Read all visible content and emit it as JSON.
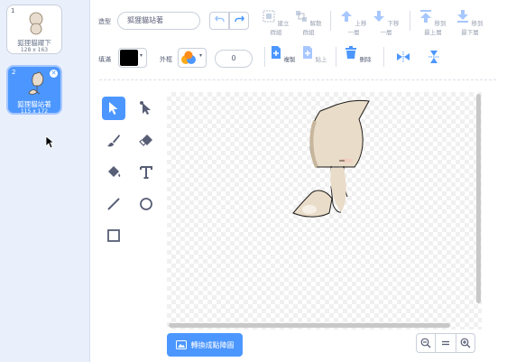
{
  "costumes": [
    {
      "num": "1",
      "name": "狐狸貓躍下",
      "size": "128 x 163"
    },
    {
      "num": "2",
      "name": "狐狸貓站著",
      "size": "115 x 172"
    }
  ],
  "editor": {
    "costume_label": "造型",
    "costume_name": "狐狸貓站著",
    "fill_label": "填滿",
    "outline_label": "外框",
    "outline_width": "0"
  },
  "toolbar": {
    "group": "建立群組",
    "ungroup": "解散群組",
    "forward": "上移一層",
    "backward": "下移一層",
    "front": "移到最上層",
    "back": "移到最下層",
    "copy": "複製",
    "paste": "貼上",
    "delete": "刪除"
  },
  "convert_label": "轉換成點陣圖",
  "colors": {
    "accent": "#4c97ff",
    "fill": "#000000"
  }
}
